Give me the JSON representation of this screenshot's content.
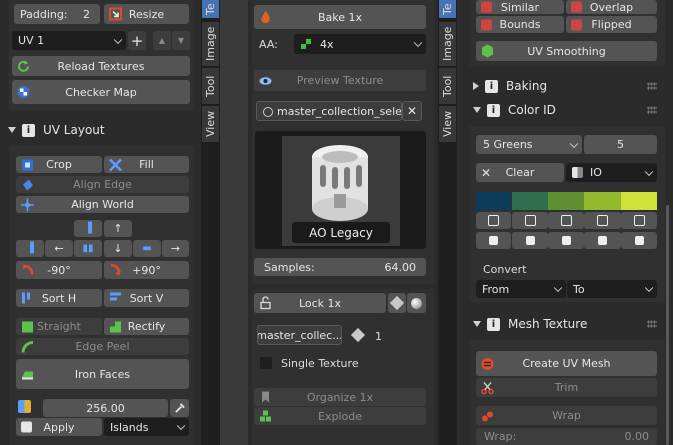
{
  "left": {
    "padding_label": "Padding:",
    "padding_value": "2",
    "resize_label": "Resize",
    "uv_map_value": "UV 1",
    "reload_label": "Reload Textures",
    "checker_label": "Checker Map",
    "section_title": "UV Layout",
    "crop_label": "Crop",
    "fill_label": "Fill",
    "align_edge_label": "Align Edge",
    "align_world_label": "Align World",
    "neg90_label": "-90°",
    "pos90_label": "+90°",
    "sort_h_label": "Sort H",
    "sort_v_label": "Sort V",
    "straight_label": "Straight",
    "rectify_label": "Rectify",
    "edge_peel_label": "Edge Peel",
    "iron_faces_label": "Iron Faces",
    "size_value": "256.00",
    "apply_label": "Apply",
    "islands_value": "Islands"
  },
  "tabs_left": [
    {
      "label": "Te"
    },
    {
      "label": "Image"
    },
    {
      "label": "Tool"
    },
    {
      "label": "View"
    }
  ],
  "mid": {
    "bake_label": "Bake 1x",
    "aa_label": "AA:",
    "aa_value": "4x",
    "preview_label": "Preview Texture",
    "collection_field": "master_collection_sele...",
    "thumb_caption": "AO Legacy",
    "samples_label": "Samples:",
    "samples_value": "64.00",
    "lock_label": "Lock 1x",
    "master_field": "master_collec...",
    "count_value": "1",
    "single_texture_label": "Single Texture",
    "organize_label": "Organize 1x",
    "explode_label": "Explode"
  },
  "tabs_right": [
    {
      "label": "Te"
    },
    {
      "label": "Image"
    },
    {
      "label": "Tool"
    },
    {
      "label": "View"
    }
  ],
  "right": {
    "similar_label": "Similar",
    "overlap_label": "Overlap",
    "bounds_label": "Bounds",
    "flipped_label": "Flipped",
    "uv_smoothing_label": "UV Smoothing",
    "baking_title": "Baking",
    "colorid_title": "Color ID",
    "palette_value": "5 Greens",
    "palette_count": "5",
    "clear_label": "Clear",
    "io_value": "IO",
    "swatches": [
      "#0d3b5c",
      "#2f6e4c",
      "#5f8f33",
      "#94b82d",
      "#cfe23a"
    ],
    "convert_label": "Convert",
    "from_value": "From",
    "to_value": "To",
    "mesh_texture_title": "Mesh Texture",
    "create_uv_mesh_label": "Create UV Mesh",
    "trim_label": "Trim",
    "wrap_label": "Wrap",
    "wrap_field_label": "Wrap:",
    "wrap_field_value": "0.00"
  },
  "colors": {
    "accent": "#4772b3",
    "button": "#545454",
    "panel": "#303030",
    "field": "#1e1e1e"
  }
}
